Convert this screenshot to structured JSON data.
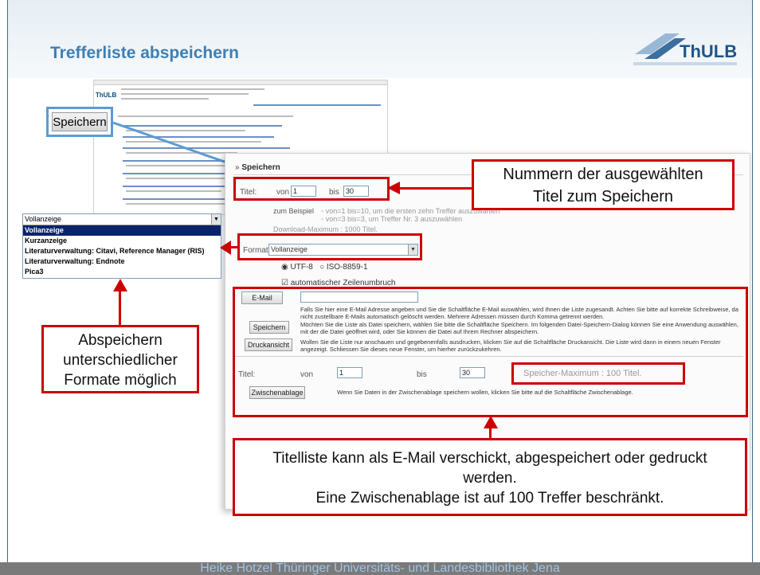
{
  "slide": {
    "title": "Trefferliste abspeichern",
    "logo_text": "ThULB",
    "footer": "Heike Hotzel   Thüringer Universitäts- und Landesbibliothek Jena"
  },
  "catalog_screenshot": {
    "button_label": "Speichern",
    "logo_text": "ThULB"
  },
  "format_dropdown": {
    "selected": "Vollanzeige",
    "options": [
      "Vollanzeige",
      "Kurzanzeige",
      "Literaturverwaltung: Citavi, Reference Manager (RIS)",
      "Literaturverwaltung: Endnote",
      "Pica3"
    ]
  },
  "form": {
    "heading": "Speichern",
    "title_label": "Titel:",
    "von_label": "von",
    "von_value": "1",
    "bis_label": "bis",
    "bis_value": "30",
    "example_prefix": "zum Beispiel",
    "example_1": "von=1 bis=10, um die ersten zehn Treffer auszuwählen",
    "example_2": "von=3 bis=3, um Treffer Nr. 3 auszuwählen",
    "download_max": "Download-Maximum : 1000 Titel.",
    "format_label": "Format:",
    "format_value": "Vollanzeige",
    "encoding_utf8": "UTF-8",
    "encoding_iso": "ISO-8859-1",
    "linebreak_label": "automatischer Zeilenumbruch",
    "email_button": "E-Mail",
    "email_text": "Falls Sie hier eine E-Mail Adresse angeben und Sie die Schaltfläche E-Mail auswählen, wird Ihnen die Liste zugesandt. Achten Sie bitte auf korrekte Schreibweise, da nicht zustellbare E-Mails automatisch gelöscht werden. Mehrere Adressen müssen durch Komma getrennt werden.",
    "save_button": "Speichern",
    "save_text": "Möchten Sie die Liste als Datei speichern, wählen Sie bitte die Schaltfläche Speichern. Im folgenden Datei-Speichern-Dialog können Sie eine Anwendung auswählen, mit der die Datei geöffnet wird, oder Sie können die Datei auf Ihrem Rechner abspeichern.",
    "print_button": "Druckansicht",
    "print_text": "Wollen Sie die Liste nur anschauen und gegebenenfalls ausdrucken, klicken Sie auf die Schaltfläche Druckansicht. Die Liste wird dann in einem neuen Fenster angezeigt. Schliessen Sie dieses neue Fenster, um hierher zurückzukehren.",
    "clip_title_label": "Titel:",
    "clip_von_label": "von",
    "clip_von_value": "1",
    "clip_bis_label": "bis",
    "clip_bis_value": "30",
    "clip_max": "Speicher-Maximum : 100 Titel.",
    "clipboard_button": "Zwischenablage",
    "clipboard_text": "Wenn Sie Daten in der Zwischenablage speichern wollen, klicken Sie bitte auf die Schaltfläche Zwischenablage."
  },
  "callouts": {
    "selected_titles": "Nummern der ausgewählten Titel zum Speichern",
    "formats": "Abspeichern unterschiedlicher Formate möglich",
    "email": "Titelliste kann als E-Mail verschickt, abgespeichert oder gedruckt werden.",
    "clipboard": "Eine Zwischenablage ist auf 100 Treffer beschränkt."
  },
  "colors": {
    "title": "#3e7fb3",
    "highlight": "#cc0000",
    "button_highlight": "#5b9bd5",
    "footer_bg": "#7a7a7a",
    "footer_text": "#9ec3e6"
  }
}
